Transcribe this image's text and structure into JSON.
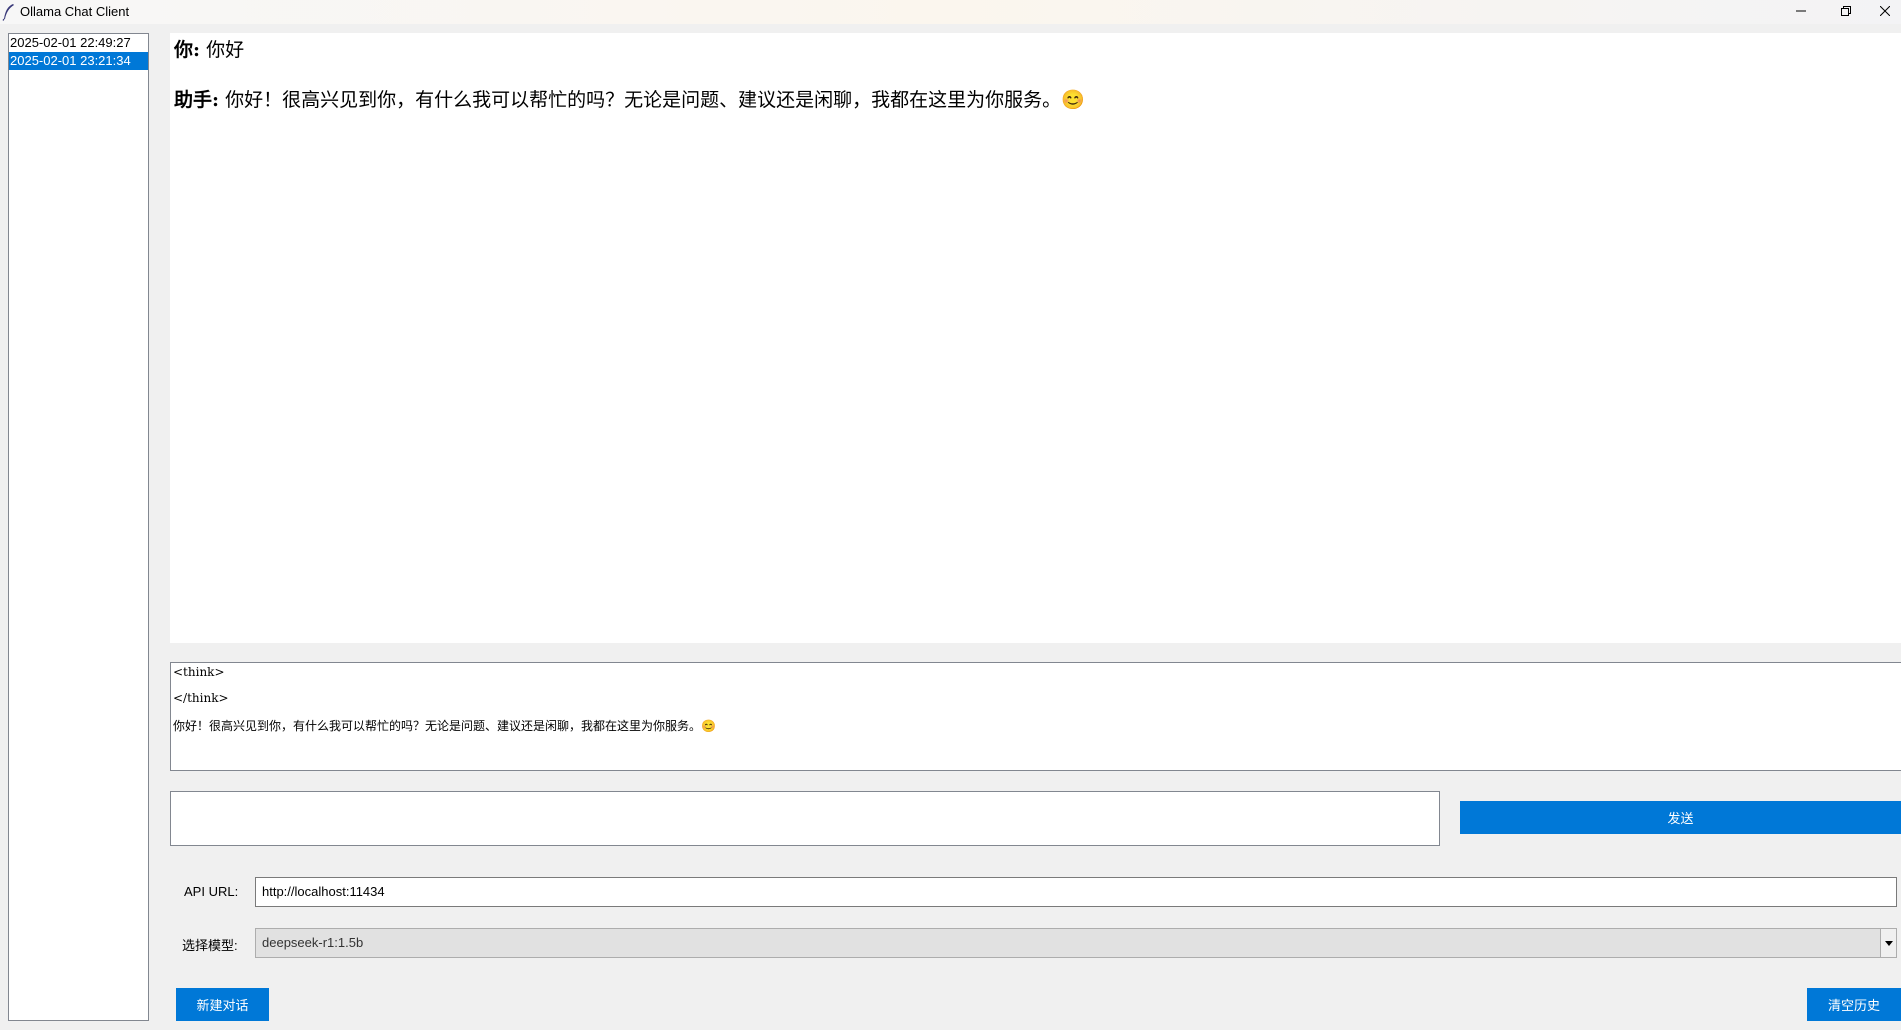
{
  "window": {
    "title": "Ollama Chat Client"
  },
  "history": {
    "items": [
      {
        "label": "2025-02-01 22:49:27",
        "selected": false
      },
      {
        "label": "2025-02-01 23:21:34",
        "selected": true
      }
    ]
  },
  "chat": {
    "messages": [
      {
        "speaker": "你:",
        "text": "你好"
      },
      {
        "speaker": "助手:",
        "text": "你好！很高兴见到你，有什么我可以帮忙的吗？无论是问题、建议还是闲聊，我都在这里为你服务。😊"
      }
    ]
  },
  "raw_output": {
    "lines": [
      "<think>",
      "</think>",
      "你好！很高兴见到你，有什么我可以帮忙的吗？无论是问题、建议还是闲聊，我都在这里为你服务。😊"
    ]
  },
  "input": {
    "value": "",
    "send_label": "发送"
  },
  "settings": {
    "api_url_label": "API URL:",
    "api_url_value": "http://localhost:11434",
    "model_label": "选择模型:",
    "model_value": "deepseek-r1:1.5b"
  },
  "actions": {
    "new_chat_label": "新建对话",
    "clear_history_label": "清空历史"
  },
  "colors": {
    "accent": "#0078d7",
    "background": "#f0f0f0"
  }
}
